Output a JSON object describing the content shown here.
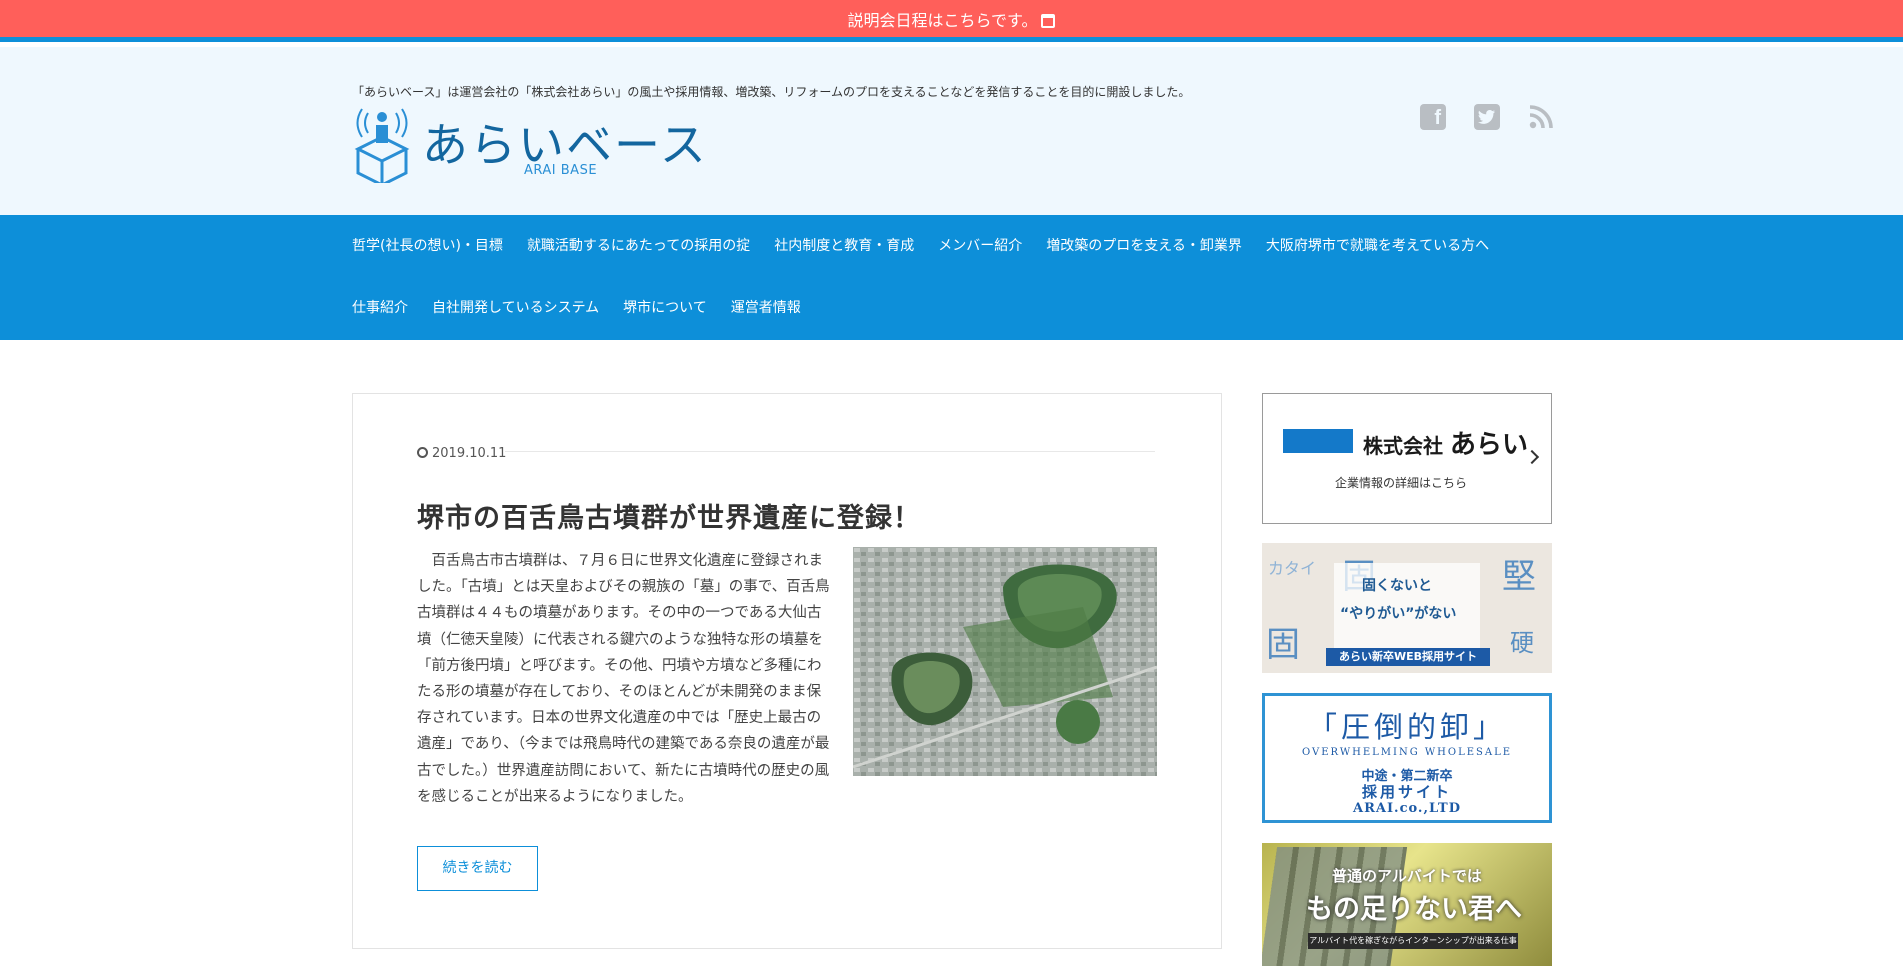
{
  "announcement": {
    "text": "説明会日程はこちらです。",
    "icon": "calendar-icon"
  },
  "header": {
    "tagline": "「あらいベース」は運営会社の「株式会社あらい」の風土や採用情報、増改築、リフォームのプロを支えることなどを発信することを目的に開設しました。",
    "site_name": "あらいベース",
    "site_sub": "ARAI BASE",
    "social": [
      "facebook-icon",
      "twitter-icon",
      "rss-icon"
    ]
  },
  "nav": {
    "row1": [
      "哲学(社長の想い)・目標",
      "就職活動するにあたっての採用の掟",
      "社内制度と教育・育成",
      "メンバー紹介",
      "増改築のプロを支える・卸業界",
      "大阪府堺市で就職を考えている方へ"
    ],
    "row2": [
      "仕事紹介",
      "自社開発しているシステム",
      "堺市について",
      "運営者情報"
    ]
  },
  "article": {
    "date": "2019.10.11",
    "title": "堺市の百舌鳥古墳群が世界遺産に登録！",
    "excerpt": "百舌鳥古市古墳群は、７月６日に世界文化遺産に登録されました。「古墳」とは天皇およびその親族の「墓」の事で、百舌鳥古墳群は４４もの墳墓があります。その中の一つである大仙古墳（仁徳天皇陵）に代表される鍵穴のような独特な形の墳墓を「前方後円墳」と呼びます。その他、円墳や方墳など多種にわたる形の墳墓が存在しており、そのほとんどが未開発のまま保存されています。日本の世界文化遺産の中では「歴史上最古の遺産」であり、（今までは飛鳥時代の建築である奈良の遺産が最古でした。）世界遺産訪問において、新たに古墳時代の歴史の風を感じることが出来るようになりました。",
    "read_more": "続きを読む"
  },
  "sidebar": {
    "corp_banner": {
      "prefix": "株式会社",
      "name": "あらい",
      "sub": "企業情報の詳細はこちら"
    },
    "recruit_banner": {
      "chars": [
        "カタイ",
        "固",
        "堅",
        "固",
        "硬"
      ],
      "line1": "固くないと",
      "line2": "“やりがい”がない",
      "caption": "あらい新卒WEB採用サイト"
    },
    "wholesale_banner": {
      "title": "「圧倒的卸」",
      "en": "OVERWHELMING WHOLESALE",
      "line1": "中途・第二新卒",
      "line2": "採用サイト",
      "logo": "ARAI.co.,LTD"
    },
    "intern_banner": {
      "line1": "普通のアルバイトでは",
      "line2": "もの足りない君へ",
      "line3": "アルバイト代を稼ぎながらインターンシップが出来る仕事"
    }
  },
  "colors": {
    "announcement": "#ff5f5a",
    "brand_blue": "#0d8fd9",
    "header_bg": "#eff8fe"
  }
}
